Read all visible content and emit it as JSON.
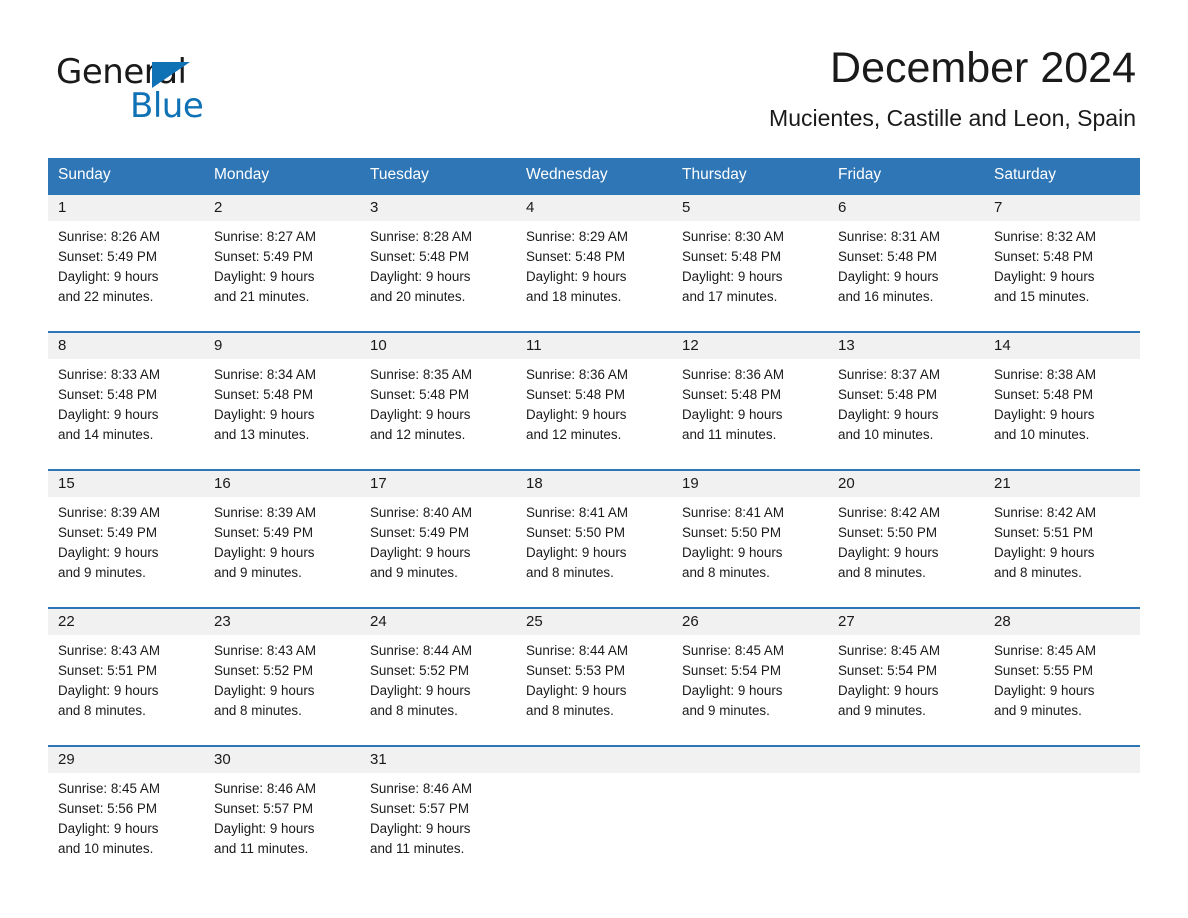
{
  "brand": {
    "name_part1": "General",
    "name_part2": "Blue",
    "accent_color": "#0f72b5"
  },
  "header": {
    "month_title": "December 2024",
    "location": "Mucientes, Castille and Leon, Spain"
  },
  "calendar": {
    "header_bg": "#2f76b6",
    "day_band_bg": "#f1f1f1",
    "weekday_names": [
      "Sunday",
      "Monday",
      "Tuesday",
      "Wednesday",
      "Thursday",
      "Friday",
      "Saturday"
    ],
    "weeks": [
      [
        {
          "day": "1",
          "sunrise": "Sunrise: 8:26 AM",
          "sunset": "Sunset: 5:49 PM",
          "daylight_line1": "Daylight: 9 hours",
          "daylight_line2": "and 22 minutes."
        },
        {
          "day": "2",
          "sunrise": "Sunrise: 8:27 AM",
          "sunset": "Sunset: 5:49 PM",
          "daylight_line1": "Daylight: 9 hours",
          "daylight_line2": "and 21 minutes."
        },
        {
          "day": "3",
          "sunrise": "Sunrise: 8:28 AM",
          "sunset": "Sunset: 5:48 PM",
          "daylight_line1": "Daylight: 9 hours",
          "daylight_line2": "and 20 minutes."
        },
        {
          "day": "4",
          "sunrise": "Sunrise: 8:29 AM",
          "sunset": "Sunset: 5:48 PM",
          "daylight_line1": "Daylight: 9 hours",
          "daylight_line2": "and 18 minutes."
        },
        {
          "day": "5",
          "sunrise": "Sunrise: 8:30 AM",
          "sunset": "Sunset: 5:48 PM",
          "daylight_line1": "Daylight: 9 hours",
          "daylight_line2": "and 17 minutes."
        },
        {
          "day": "6",
          "sunrise": "Sunrise: 8:31 AM",
          "sunset": "Sunset: 5:48 PM",
          "daylight_line1": "Daylight: 9 hours",
          "daylight_line2": "and 16 minutes."
        },
        {
          "day": "7",
          "sunrise": "Sunrise: 8:32 AM",
          "sunset": "Sunset: 5:48 PM",
          "daylight_line1": "Daylight: 9 hours",
          "daylight_line2": "and 15 minutes."
        }
      ],
      [
        {
          "day": "8",
          "sunrise": "Sunrise: 8:33 AM",
          "sunset": "Sunset: 5:48 PM",
          "daylight_line1": "Daylight: 9 hours",
          "daylight_line2": "and 14 minutes."
        },
        {
          "day": "9",
          "sunrise": "Sunrise: 8:34 AM",
          "sunset": "Sunset: 5:48 PM",
          "daylight_line1": "Daylight: 9 hours",
          "daylight_line2": "and 13 minutes."
        },
        {
          "day": "10",
          "sunrise": "Sunrise: 8:35 AM",
          "sunset": "Sunset: 5:48 PM",
          "daylight_line1": "Daylight: 9 hours",
          "daylight_line2": "and 12 minutes."
        },
        {
          "day": "11",
          "sunrise": "Sunrise: 8:36 AM",
          "sunset": "Sunset: 5:48 PM",
          "daylight_line1": "Daylight: 9 hours",
          "daylight_line2": "and 12 minutes."
        },
        {
          "day": "12",
          "sunrise": "Sunrise: 8:36 AM",
          "sunset": "Sunset: 5:48 PM",
          "daylight_line1": "Daylight: 9 hours",
          "daylight_line2": "and 11 minutes."
        },
        {
          "day": "13",
          "sunrise": "Sunrise: 8:37 AM",
          "sunset": "Sunset: 5:48 PM",
          "daylight_line1": "Daylight: 9 hours",
          "daylight_line2": "and 10 minutes."
        },
        {
          "day": "14",
          "sunrise": "Sunrise: 8:38 AM",
          "sunset": "Sunset: 5:48 PM",
          "daylight_line1": "Daylight: 9 hours",
          "daylight_line2": "and 10 minutes."
        }
      ],
      [
        {
          "day": "15",
          "sunrise": "Sunrise: 8:39 AM",
          "sunset": "Sunset: 5:49 PM",
          "daylight_line1": "Daylight: 9 hours",
          "daylight_line2": "and 9 minutes."
        },
        {
          "day": "16",
          "sunrise": "Sunrise: 8:39 AM",
          "sunset": "Sunset: 5:49 PM",
          "daylight_line1": "Daylight: 9 hours",
          "daylight_line2": "and 9 minutes."
        },
        {
          "day": "17",
          "sunrise": "Sunrise: 8:40 AM",
          "sunset": "Sunset: 5:49 PM",
          "daylight_line1": "Daylight: 9 hours",
          "daylight_line2": "and 9 minutes."
        },
        {
          "day": "18",
          "sunrise": "Sunrise: 8:41 AM",
          "sunset": "Sunset: 5:50 PM",
          "daylight_line1": "Daylight: 9 hours",
          "daylight_line2": "and 8 minutes."
        },
        {
          "day": "19",
          "sunrise": "Sunrise: 8:41 AM",
          "sunset": "Sunset: 5:50 PM",
          "daylight_line1": "Daylight: 9 hours",
          "daylight_line2": "and 8 minutes."
        },
        {
          "day": "20",
          "sunrise": "Sunrise: 8:42 AM",
          "sunset": "Sunset: 5:50 PM",
          "daylight_line1": "Daylight: 9 hours",
          "daylight_line2": "and 8 minutes."
        },
        {
          "day": "21",
          "sunrise": "Sunrise: 8:42 AM",
          "sunset": "Sunset: 5:51 PM",
          "daylight_line1": "Daylight: 9 hours",
          "daylight_line2": "and 8 minutes."
        }
      ],
      [
        {
          "day": "22",
          "sunrise": "Sunrise: 8:43 AM",
          "sunset": "Sunset: 5:51 PM",
          "daylight_line1": "Daylight: 9 hours",
          "daylight_line2": "and 8 minutes."
        },
        {
          "day": "23",
          "sunrise": "Sunrise: 8:43 AM",
          "sunset": "Sunset: 5:52 PM",
          "daylight_line1": "Daylight: 9 hours",
          "daylight_line2": "and 8 minutes."
        },
        {
          "day": "24",
          "sunrise": "Sunrise: 8:44 AM",
          "sunset": "Sunset: 5:52 PM",
          "daylight_line1": "Daylight: 9 hours",
          "daylight_line2": "and 8 minutes."
        },
        {
          "day": "25",
          "sunrise": "Sunrise: 8:44 AM",
          "sunset": "Sunset: 5:53 PM",
          "daylight_line1": "Daylight: 9 hours",
          "daylight_line2": "and 8 minutes."
        },
        {
          "day": "26",
          "sunrise": "Sunrise: 8:45 AM",
          "sunset": "Sunset: 5:54 PM",
          "daylight_line1": "Daylight: 9 hours",
          "daylight_line2": "and 9 minutes."
        },
        {
          "day": "27",
          "sunrise": "Sunrise: 8:45 AM",
          "sunset": "Sunset: 5:54 PM",
          "daylight_line1": "Daylight: 9 hours",
          "daylight_line2": "and 9 minutes."
        },
        {
          "day": "28",
          "sunrise": "Sunrise: 8:45 AM",
          "sunset": "Sunset: 5:55 PM",
          "daylight_line1": "Daylight: 9 hours",
          "daylight_line2": "and 9 minutes."
        }
      ],
      [
        {
          "day": "29",
          "sunrise": "Sunrise: 8:45 AM",
          "sunset": "Sunset: 5:56 PM",
          "daylight_line1": "Daylight: 9 hours",
          "daylight_line2": "and 10 minutes."
        },
        {
          "day": "30",
          "sunrise": "Sunrise: 8:46 AM",
          "sunset": "Sunset: 5:57 PM",
          "daylight_line1": "Daylight: 9 hours",
          "daylight_line2": "and 11 minutes."
        },
        {
          "day": "31",
          "sunrise": "Sunrise: 8:46 AM",
          "sunset": "Sunset: 5:57 PM",
          "daylight_line1": "Daylight: 9 hours",
          "daylight_line2": "and 11 minutes."
        },
        {
          "day": "",
          "sunrise": "",
          "sunset": "",
          "daylight_line1": "",
          "daylight_line2": ""
        },
        {
          "day": "",
          "sunrise": "",
          "sunset": "",
          "daylight_line1": "",
          "daylight_line2": ""
        },
        {
          "day": "",
          "sunrise": "",
          "sunset": "",
          "daylight_line1": "",
          "daylight_line2": ""
        },
        {
          "day": "",
          "sunrise": "",
          "sunset": "",
          "daylight_line1": "",
          "daylight_line2": ""
        }
      ]
    ]
  }
}
